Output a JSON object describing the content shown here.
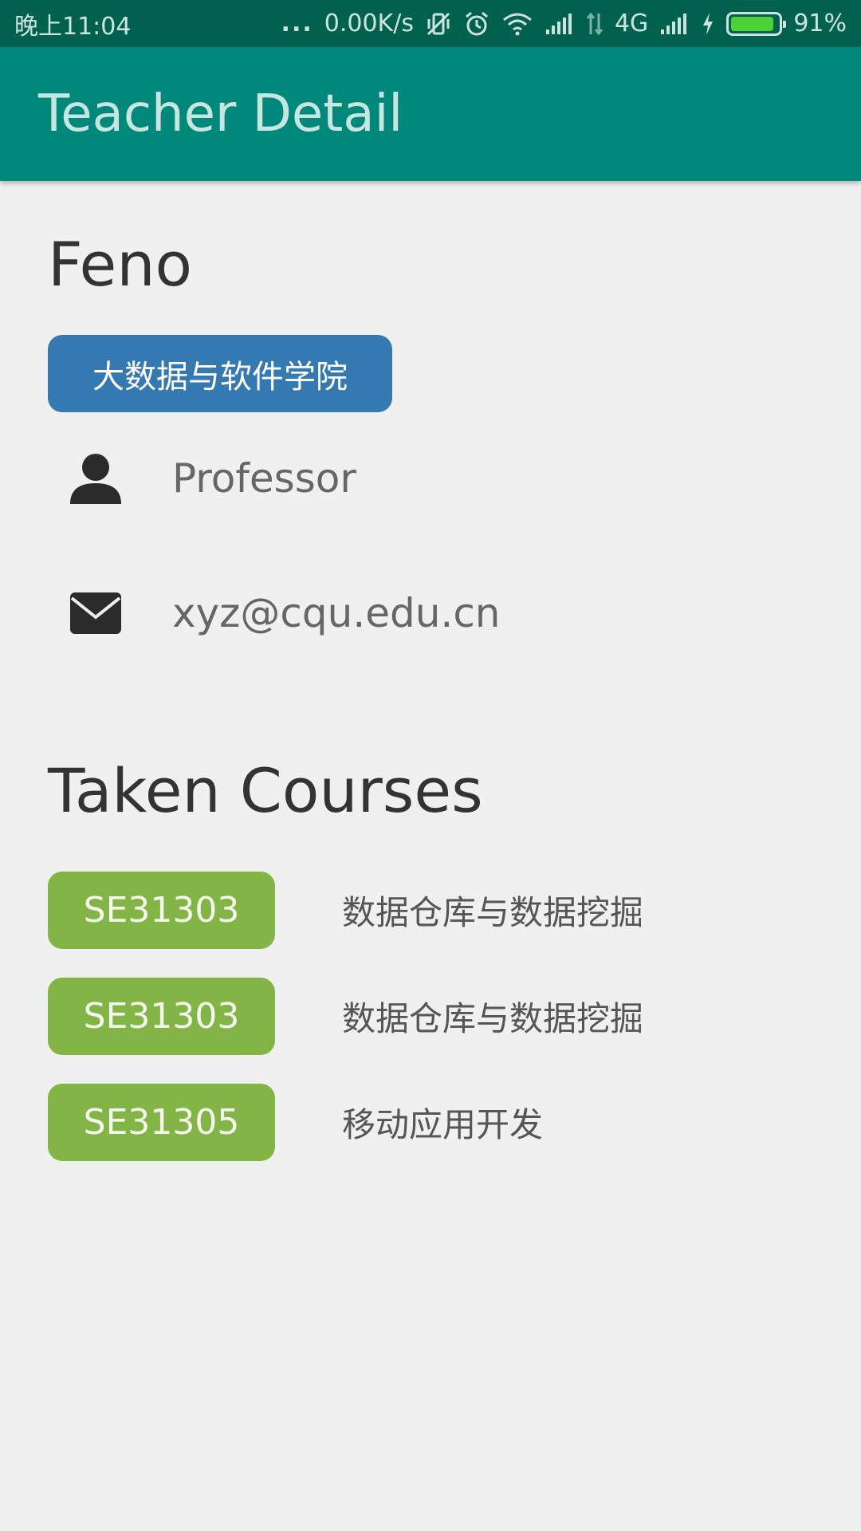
{
  "status_bar": {
    "time": "晚上11:04",
    "dots": "...",
    "network_speed": "0.00K/s",
    "network_type": "4G",
    "battery_percent": "91%",
    "battery_level": 0.91,
    "icons": [
      "vibrate-off-icon",
      "alarm-icon",
      "wifi-icon",
      "signal-icon",
      "data-arrows-icon",
      "signal-icon",
      "charging-icon",
      "battery-icon"
    ]
  },
  "toolbar": {
    "title": "Teacher Detail"
  },
  "teacher": {
    "name": "Feno",
    "department": "大数据与软件学院",
    "title": "Professor",
    "email": "xyz@cqu.edu.cn"
  },
  "courses_section": {
    "heading": "Taken Courses",
    "items": [
      {
        "code": "SE31303",
        "name": "数据仓库与数据挖掘"
      },
      {
        "code": "SE31303",
        "name": "数据仓库与数据挖掘"
      },
      {
        "code": "SE31305",
        "name": "移动应用开发"
      }
    ]
  },
  "colors": {
    "status_bar": "#00614f",
    "toolbar": "#00897b",
    "department_badge": "#3579b2",
    "course_badge": "#82b446",
    "background": "#f0f0f0"
  }
}
